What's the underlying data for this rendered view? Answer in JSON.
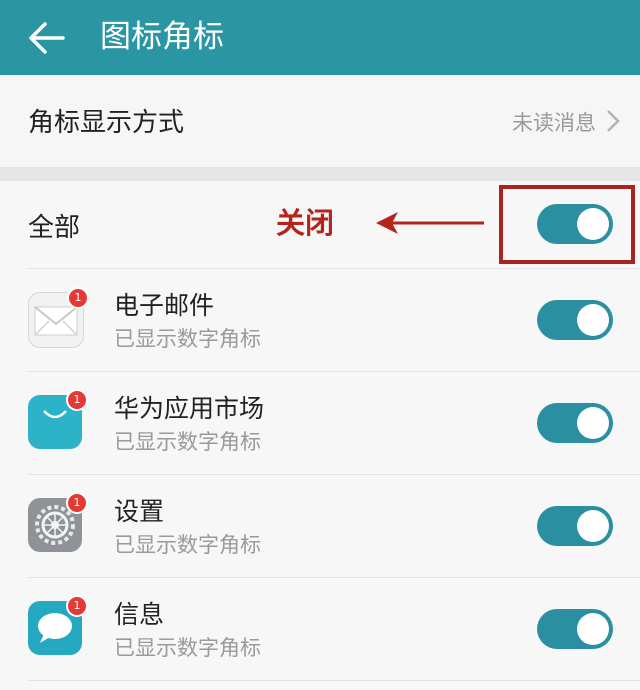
{
  "header": {
    "title": "图标角标",
    "back_icon": "arrow-left-icon",
    "color": "#2a96a4"
  },
  "badge_mode": {
    "label": "角标显示方式",
    "value": "未读消息"
  },
  "all_toggle": {
    "label": "全部",
    "on": true
  },
  "annotation": {
    "text": "关闭",
    "color": "#b3241c"
  },
  "apps": [
    {
      "name": "电子邮件",
      "status": "已显示数字角标",
      "icon": "mail-icon",
      "badge": "1",
      "on": true
    },
    {
      "name": "华为应用市场",
      "status": "已显示数字角标",
      "icon": "app-market-icon",
      "badge": "1",
      "on": true
    },
    {
      "name": "设置",
      "status": "已显示数字角标",
      "icon": "settings-gear-icon",
      "badge": "1",
      "on": true
    },
    {
      "name": "信息",
      "status": "已显示数字角标",
      "icon": "message-bubble-icon",
      "badge": "1",
      "on": true
    }
  ]
}
